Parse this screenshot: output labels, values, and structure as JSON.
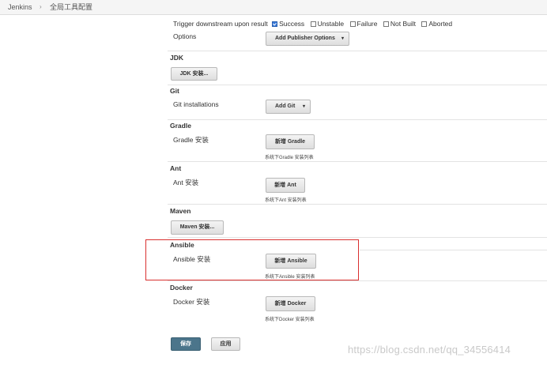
{
  "breadcrumb": {
    "root": "Jenkins",
    "separator": "›",
    "current": "全局工具配置"
  },
  "trigger": {
    "label": "Trigger downstream upon result",
    "options": [
      {
        "label": "Success",
        "checked": true
      },
      {
        "label": "Unstable",
        "checked": false
      },
      {
        "label": "Failure",
        "checked": false
      },
      {
        "label": "Not Built",
        "checked": false
      },
      {
        "label": "Aborted",
        "checked": false
      }
    ]
  },
  "options": {
    "label": "Options",
    "button": "Add Publisher Options",
    "caret": "▾"
  },
  "jdk": {
    "title": "JDK",
    "button": "JDK 安装..."
  },
  "git": {
    "title": "Git",
    "label": "Git installations",
    "button": "Add Git",
    "caret": "▾"
  },
  "gradle": {
    "title": "Gradle",
    "label": "Gradle 安装",
    "button": "新增 Gradle",
    "help": "系统下Gradle 安装列表"
  },
  "ant": {
    "title": "Ant",
    "label": "Ant 安装",
    "button": "新增 Ant",
    "help": "系统下Ant 安装列表"
  },
  "maven": {
    "title": "Maven",
    "button": "Maven 安装..."
  },
  "ansible": {
    "title": "Ansible",
    "label": "Ansible 安装",
    "button": "新增 Ansible",
    "help": "系统下Ansible 安装列表"
  },
  "docker": {
    "title": "Docker",
    "label": "Docker 安装",
    "button": "新增 Docker",
    "help": "系统下Docker 安装列表"
  },
  "footer": {
    "save": "保存",
    "apply": "应用"
  },
  "watermark": "https://blog.csdn.net/qq_34556414",
  "colors": {
    "highlight": "#d9302f",
    "primary": "#4b758b"
  }
}
